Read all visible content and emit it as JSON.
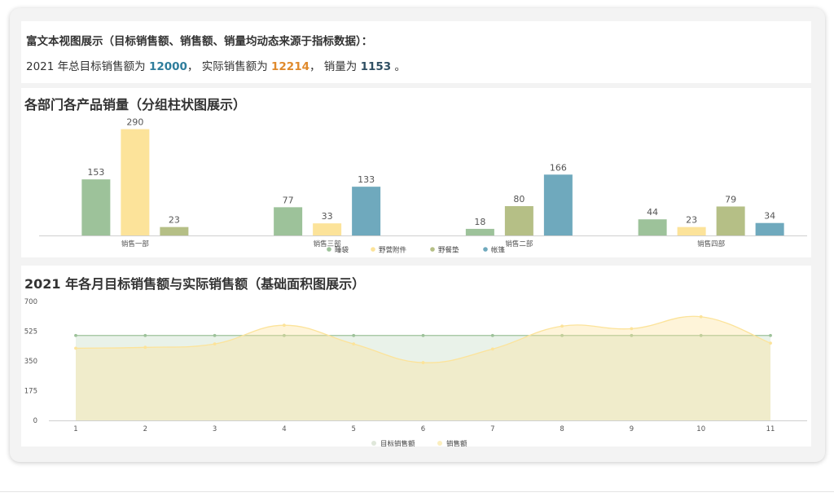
{
  "richtext": {
    "intro": "富文本视图展示（目标销售额、销售额、销量均动态来源于指标数据）：",
    "prefix": "2021 年总目标销售额为 ",
    "target_total": "12000",
    "sep1": "， 实际销售额为 ",
    "actual_total": "12214",
    "sep2": "， 销量为 ",
    "volume_total": "1153",
    "suffix": " 。",
    "colors": {
      "target": "#2e7d9c",
      "actual": "#e08a2c",
      "volume": "#2f4f63"
    }
  },
  "bar_section": {
    "title": "各部门各产品销量（分组柱状图展示）"
  },
  "area_section": {
    "title": "2021 年各月目标销售额与实际销售额（基础面积图展示）"
  },
  "chart_data": [
    {
      "type": "bar",
      "categories": [
        "销售一部",
        "销售三部",
        "销售二部",
        "销售四部"
      ],
      "series": [
        {
          "name": "睡袋",
          "color": "#9dc29a",
          "values": [
            153,
            77,
            18,
            44
          ]
        },
        {
          "name": "野营附件",
          "color": "#fce39a",
          "values": [
            290,
            33,
            null,
            23
          ]
        },
        {
          "name": "野餐垫",
          "color": "#b5bf86",
          "values": [
            23,
            null,
            80,
            79
          ]
        },
        {
          "name": "帐篷",
          "color": "#6fa9bd",
          "values": [
            null,
            133,
            166,
            34
          ]
        }
      ],
      "legend": "bottom-center",
      "ylim": [
        0,
        300
      ],
      "grid": false
    },
    {
      "type": "area",
      "x": [
        1,
        2,
        3,
        4,
        5,
        6,
        7,
        8,
        9,
        10,
        11
      ],
      "yticks": [
        0,
        175,
        350,
        525,
        700
      ],
      "ylim": [
        0,
        700
      ],
      "series": [
        {
          "name": "目标销售额",
          "color": "#9dc29a",
          "values": [
            500,
            500,
            500,
            500,
            500,
            500,
            500,
            500,
            500,
            500,
            500
          ]
        },
        {
          "name": "销售额",
          "color": "#fce39a",
          "values": [
            425,
            430,
            450,
            560,
            450,
            340,
            420,
            555,
            540,
            610,
            455
          ]
        }
      ],
      "legend": "bottom-center",
      "grid": false
    }
  ]
}
